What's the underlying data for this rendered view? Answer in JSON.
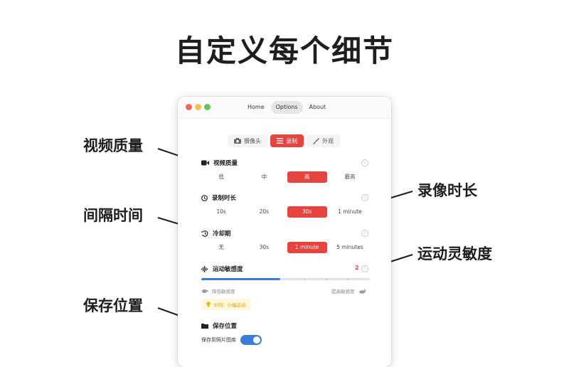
{
  "headline": "自定义每个细节",
  "callouts": {
    "video_quality": "视频质量",
    "interval": "间隔时间",
    "save_location": "保存位置",
    "record_length": "录像时长",
    "motion_sensitivity": "运动灵敏度"
  },
  "window": {
    "nav_tabs": [
      "Home",
      "Options",
      "About"
    ],
    "active_nav": "Options",
    "segments": [
      {
        "label": "摄像头",
        "icon": "camera-icon"
      },
      {
        "label": "录制",
        "icon": "list-icon"
      },
      {
        "label": "外观",
        "icon": "brush-icon"
      }
    ],
    "active_segment": "录制",
    "video_quality": {
      "title": "视频质量",
      "options": [
        "低",
        "中",
        "高",
        "最高"
      ],
      "selected": "高"
    },
    "record_length": {
      "title": "录制时长",
      "options": [
        "10s",
        "20s",
        "30s",
        "1 minute"
      ],
      "selected": "30s"
    },
    "cooldown": {
      "title": "冷却期",
      "options": [
        "无",
        "30s",
        "1 minute",
        "5 minutes"
      ],
      "selected": "1 minute"
    },
    "sensitivity": {
      "title": "运动敏感度",
      "value": "2",
      "level_fraction": 0.47,
      "low_label": "降低敏感度",
      "high_label": "提高敏感度",
      "example": "示例：小幅运动"
    },
    "save": {
      "title": "保存位置",
      "toggle_label": "保存到照片图库",
      "enabled": true
    }
  },
  "colors": {
    "accent_red": "#e8443f",
    "accent_blue": "#3a7bdc",
    "traffic_red": "#ed6a5e",
    "traffic_yellow": "#f5bf4f",
    "traffic_green": "#62c554"
  }
}
